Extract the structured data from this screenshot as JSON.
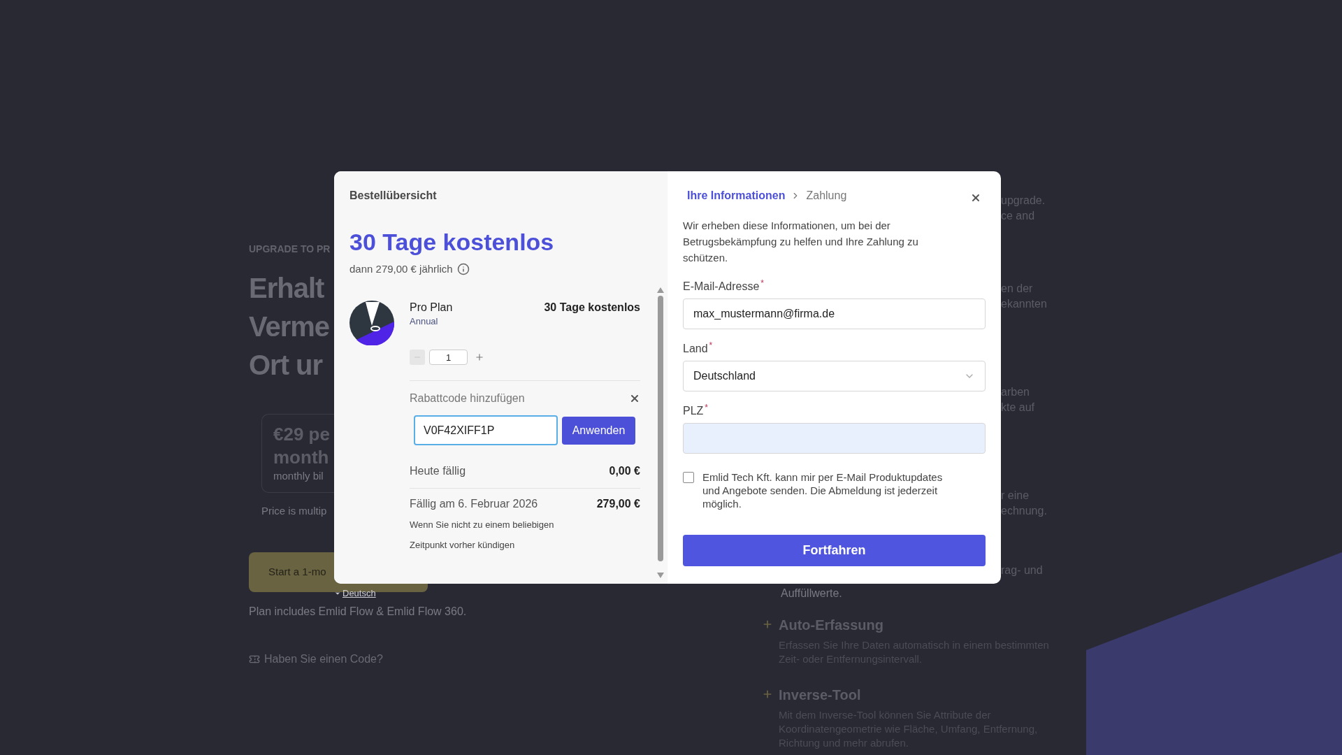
{
  "background": {
    "eyebrow": "UPGRADE TO PR",
    "headline_lines": [
      "Erhalt",
      "Verme",
      "Ort ur"
    ],
    "price_card": {
      "price": "€29 pe",
      "period": "month",
      "billing": "monthly bil"
    },
    "price_note": "Price is multip",
    "start_button": "Start a 1-mo",
    "plan_note": "Plan includes Emlid Flow & Emlid Flow 360.",
    "code_link": "Haben Sie einen Code?",
    "right_fragments": [
      [
        "upgrade.",
        "ce and"
      ],
      [
        "en der",
        "ekannten"
      ],
      [
        "arben",
        "kte auf"
      ],
      [
        "r eine",
        "echnung."
      ],
      [
        "rag- und"
      ]
    ],
    "cut_line": "Auffüllwerte.",
    "features": [
      {
        "title": "Auto-Erfassung",
        "description": "Erfassen Sie Ihre Daten automatisch in einem bestimmten Zeit- oder Entfernungsintervall."
      },
      {
        "title": "Inverse-Tool",
        "description": "Mit dem Inverse-Tool können Sie Attribute der Koordinatengeometrie wie Fläche, Umfang, Entfernung, Richtung und mehr abrufen."
      }
    ]
  },
  "language_link": "Deutsch",
  "order_summary": {
    "title": "Bestellübersicht",
    "headline": "30 Tage kostenlos",
    "subline": "dann 279,00 € jährlich",
    "item": {
      "name": "Pro Plan",
      "billing": "Annual",
      "price": "30 Tage kostenlos",
      "quantity": "1"
    },
    "discount": {
      "label": "Rabattcode hinzufügen",
      "code": "V0F42XIFF1P",
      "focused": true,
      "apply": "Anwenden"
    },
    "today": {
      "label": "Heute fällig",
      "amount": "0,00 €"
    },
    "due": {
      "label": "Fällig am 6. Februar 2026",
      "amount": "279,00 €",
      "note_lines": [
        "Wenn Sie nicht zu einem beliebigen",
        "Zeitpunkt vorher kündigen"
      ]
    }
  },
  "checkout": {
    "steps": [
      {
        "label": "Ihre Informationen",
        "selected": true
      },
      {
        "label": "Zahlung",
        "selected": false
      }
    ],
    "intro": "Wir erheben diese Informationen, um bei der Betrugsbekämpfung zu helfen und Ihre Zahlung zu schützen.",
    "fields": [
      {
        "kind": "text",
        "label": "E-Mail-Adresse",
        "required_mark": "*",
        "value": "max_mustermann@firma.de",
        "autofilled": false
      },
      {
        "kind": "select",
        "label": "Land",
        "required_mark": "*",
        "value": "Deutschland",
        "autofilled": false
      },
      {
        "kind": "text",
        "label": "PLZ",
        "required_mark": "*",
        "autofilled": true
      }
    ],
    "consent": {
      "text": "Emlid Tech Kft. kann mir per E-Mail Produktupdates und Angebote senden. Die Abmeldung ist jederzeit möglich.",
      "checked": false
    },
    "submit": "Fortfahren"
  }
}
